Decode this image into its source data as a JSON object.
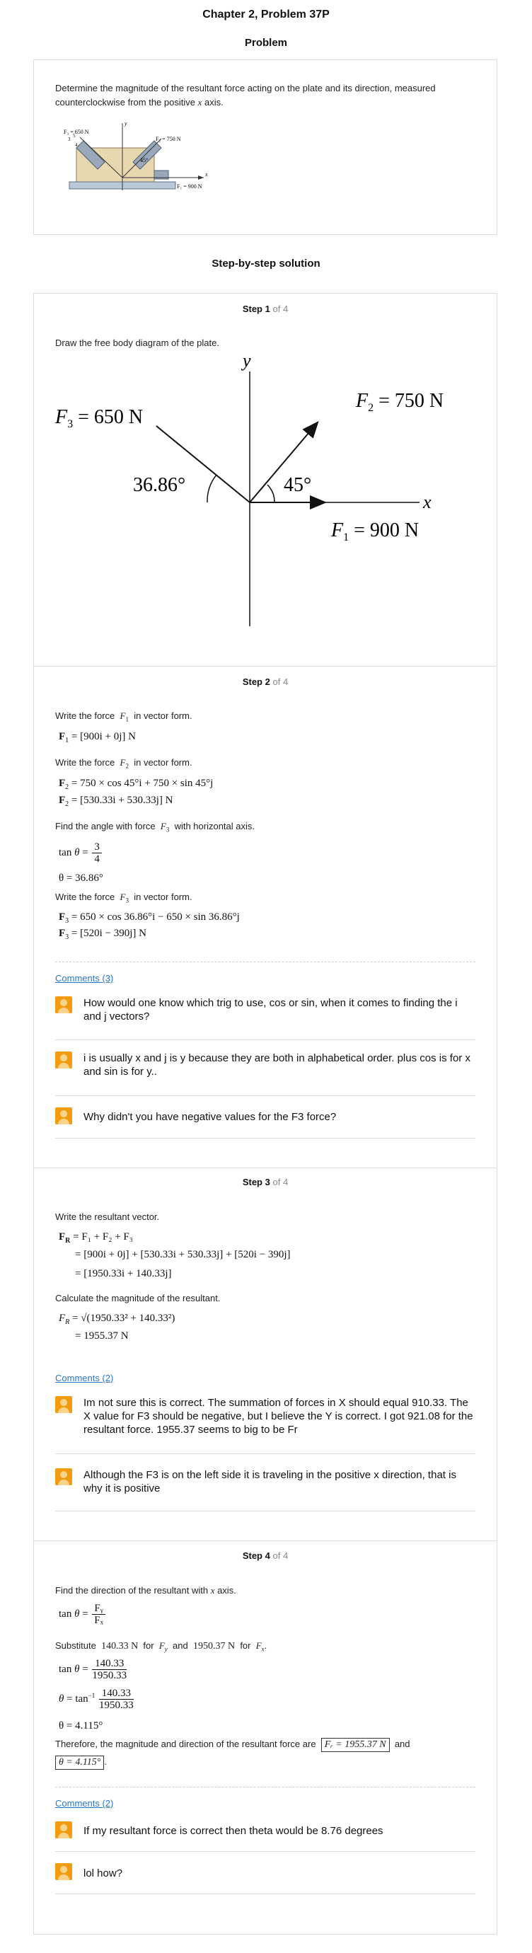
{
  "header": {
    "chapter_title": "Chapter 2, Problem 37P",
    "problem_heading": "Problem",
    "solution_heading": "Step-by-step solution"
  },
  "problem": {
    "text_before": "Determine the magnitude of the resultant force acting on the plate and its direction, measured counterclockwise from the positive ",
    "text_var": "x",
    "text_after": " axis.",
    "figure_labels": {
      "f3": "F₃ = 650 N",
      "f2": "F₂ = 750 N",
      "f1": "F₁ = 900 N",
      "angle": "45°",
      "x": "x",
      "y": "y",
      "r3": "3",
      "r4": "4",
      "r5": "5"
    }
  },
  "steps": [
    {
      "label": "Step",
      "num": "1",
      "of": "of 4",
      "text": "Draw the free body diagram of the plate.",
      "fbd": {
        "y": "y",
        "x": "x",
        "f3": "F",
        "f3sub": "3",
        "f3val": " = 650 N",
        "f2": "F",
        "f2sub": "2",
        "f2val": " = 750 N",
        "f1": "F",
        "f1sub": "1",
        "f1val": " = 900 N",
        "ang1": "36.86°",
        "ang2": "45°"
      }
    },
    {
      "label": "Step",
      "num": "2",
      "of": "of 4",
      "t1a": "Write the force",
      "t1v": "F",
      "t1s": "1",
      "t1b": "in vector form.",
      "m1": "[900i + 0j] N",
      "t2a": "Write the force",
      "t2v": "F",
      "t2s": "2",
      "t2b": "in vector form.",
      "m2a": "= 750 × cos 45°i + 750 × sin 45°j",
      "m2b": "= [530.33i + 530.33j] N",
      "t3a": "Find the angle with force",
      "t3v": "F",
      "t3s": "3",
      "t3b": "with horizontal axis.",
      "tan_num": "3",
      "tan_den": "4",
      "theta": "θ = 36.86°",
      "t4a": "Write the force",
      "t4v": "F",
      "t4s": "3",
      "t4b": "in vector form.",
      "m3a": "= 650 × cos 36.86°i − 650 × sin 36.86°j",
      "m3b": "= [520i − 390j] N",
      "comments_link": "Comments (3)",
      "comments": [
        "How would one know which trig to use, cos or sin, when it comes to finding the i and j vectors?",
        "i is usually x and j is y because they are both in alphabetical order. plus cos is for x and sin is for y..",
        "Why didn't you have negative values for the F3 force?"
      ]
    },
    {
      "label": "Step",
      "num": "3",
      "of": "of 4",
      "t1": "Write the resultant vector.",
      "m1": "= F₁ + F₂ + F₃",
      "m2": "= [900i + 0j] + [530.33i + 530.33j] + [520i − 390j]",
      "m3": "= [1950.33i + 140.33j]",
      "t2": "Calculate the magnitude of the resultant.",
      "m4": "= √(1950.33² + 140.33²)",
      "m5": "= 1955.37 N",
      "comments_link": "Comments (2)",
      "comments": [
        "Im not sure this is correct. The summation of forces in X should equal 910.33. The X value for F3 should be negative, but I believe the Y is correct. I got 921.08 for the resultant force. 1955.37 seems to big to be Fr",
        "Although the F3 is on the left side it is traveling in the positive x direction, that is why it is positive"
      ]
    },
    {
      "label": "Step",
      "num": "4",
      "of": "of 4",
      "t1a": "Find the direction of the resultant with ",
      "t1v": "x",
      "t1b": " axis.",
      "f1num": "Fᵧ",
      "f1den": "Fₓ",
      "t2a": "Substitute",
      "t2b": "140.33 N",
      "t2c": "for",
      "t2d": "F",
      "t2ds": "y",
      "t2e": "and",
      "t2f": "1950.37 N",
      "t2g": "for",
      "t2h": "F",
      "t2hs": "x",
      "t2i": ".",
      "f2num": "140.33",
      "f2den": "1950.33",
      "f3num": "140.33",
      "f3den": "1950.33",
      "theta": "θ = 4.115°",
      "t3a": "Therefore, the magnitude and direction of the resultant force are",
      "box1": "Fᵣ = 1955.37 N",
      "t3b": "and",
      "box2": "θ = 4.115°",
      "t3c": ".",
      "comments_link": "Comments (2)",
      "comments": [
        "If my resultant force is correct then theta would be 8.76 degrees",
        "lol how?"
      ]
    }
  ]
}
